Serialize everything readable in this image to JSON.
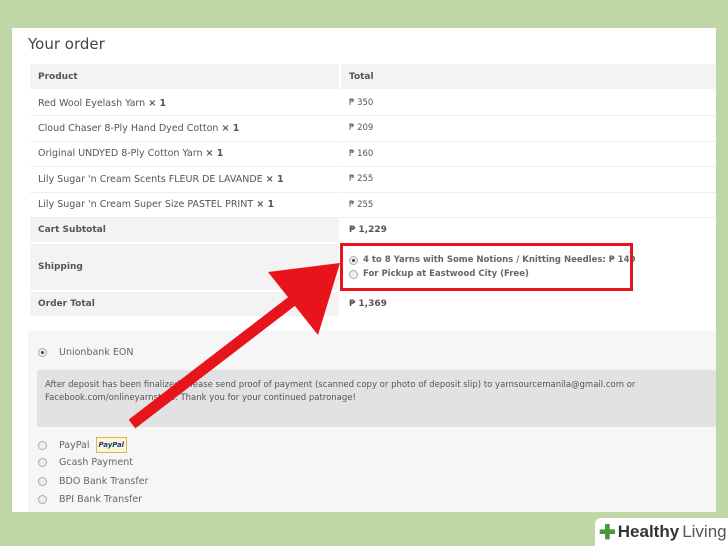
{
  "title": "Your order",
  "table": {
    "headers": [
      "Product",
      "Total"
    ],
    "items": [
      {
        "name": "Red Wool Eyelash Yarn",
        "qty": "× 1",
        "total": "₱ 350"
      },
      {
        "name": "Cloud Chaser 8-Ply Hand Dyed Cotton",
        "qty": "× 1",
        "total": "₱ 209"
      },
      {
        "name": "Original UNDYED 8-Ply Cotton Yarn",
        "qty": "× 1",
        "total": "₱ 160"
      },
      {
        "name": "Lily Sugar 'n Cream Scents FLEUR DE LAVANDE",
        "qty": "× 1",
        "total": "₱ 255"
      },
      {
        "name": "Lily Sugar 'n Cream Super Size PASTEL PRINT",
        "qty": "× 1",
        "total": "₱ 255"
      }
    ],
    "subtotal_label": "Cart Subtotal",
    "subtotal": "₱ 1,229",
    "shipping_label": "Shipping",
    "shipping_options": [
      "4 to 8 Yarns with Some Notions / Knitting Needles: ₱ 140",
      "For Pickup at Eastwood City (Free)"
    ],
    "total_label": "Order Total",
    "total": "₱ 1,369"
  },
  "payment": {
    "selected": "Unionbank EON",
    "description": "After deposit has been finalized, please send proof of payment (scanned copy or photo of deposit slip) to yarnsourcemanila@gmail.com or Facebook.com/onlineyarnstore. Thank you for your continued patronage!",
    "others": [
      "PayPal",
      "Gcash Payment",
      "BDO Bank Transfer",
      "BPI Bank Transfer"
    ],
    "paypal_badge": "PayPal"
  },
  "logo": {
    "bold": "Healthy",
    "light": "Living"
  },
  "colors": {
    "highlight": "#e8141b",
    "background": "#bfd6a6"
  }
}
